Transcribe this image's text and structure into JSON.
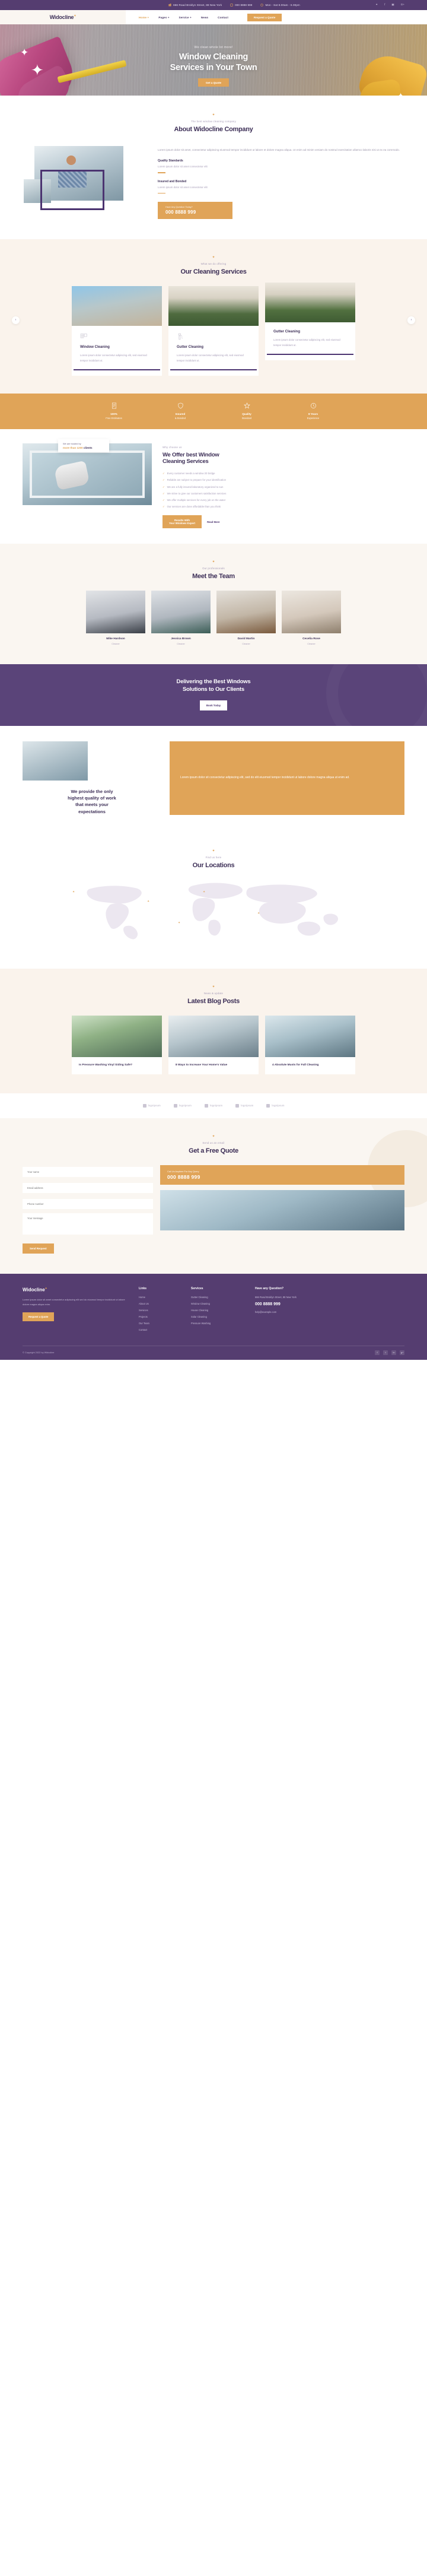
{
  "topbar": {
    "address": "666 Road Broklyn Street, 88 New York",
    "phone": "000 8888 999",
    "hours": "Mon - Sat 8.00am - 6.00pm",
    "social": [
      "twitter-icon",
      "facebook-icon",
      "instagram-icon",
      "google-plus-icon"
    ]
  },
  "nav": {
    "logo": "Widocline",
    "items": [
      {
        "label": "Home +",
        "active": true
      },
      {
        "label": "Pages +",
        "active": false
      },
      {
        "label": "Service +",
        "active": false
      },
      {
        "label": "News",
        "active": false
      },
      {
        "label": "Contact",
        "active": false
      }
    ],
    "cta": "Request a Quote"
  },
  "hero": {
    "eyebrow": "We clean whole lot more!",
    "title_line1": "Window Cleaning",
    "title_line2": "Services in Your Town",
    "button": "Get a Quote"
  },
  "about": {
    "eyebrow": "The best window cleaning company",
    "title": "About Widocline Company",
    "paragraph": "Lorem ipsum dolor sit amet, consectetur adipiscing eiusmod tempor incididunt ut labore et dolore magna aliqua. Ut enim ad minim veniam do nostrud exercitation ullamco laboris nisi ut ex ea commodo.",
    "features": [
      {
        "title": "Quality Standards",
        "text": "Lorem ipsum dolor sit amet consectetur elit"
      },
      {
        "title": "Insured and Bonded",
        "text": "Lorem ipsum dolor sit amet consectetur elit"
      }
    ],
    "call_label": "Have Any Question Today?",
    "call_number": "000 8888 999"
  },
  "services": {
    "eyebrow": "What we do offering",
    "title": "Our Cleaning Services",
    "cards": [
      {
        "title": "Window Cleaning",
        "text": "Lorem ipsum dolor consectetur adipiscing elit, sed eiusmod tempor incididunt ut.",
        "icon": "window-icon"
      },
      {
        "title": "Gutter Cleaning",
        "text": "Lorem ipsum dolor consectetur adipiscing elit, sed eiusmod tempor incididunt ut.",
        "icon": "gutter-icon"
      },
      {
        "title": "Gutter Cleaning",
        "text": "Lorem ipsum dolor consectetur adipiscing elit, sed eiusmod tempor incididunt ut.",
        "icon": "gutter-icon"
      }
    ],
    "prev": "‹",
    "next": "›"
  },
  "stats": [
    {
      "icon": "document-icon",
      "title": "100%",
      "sub": "Free Estimates"
    },
    {
      "icon": "shield-icon",
      "title": "Insured",
      "sub": "& Bonded"
    },
    {
      "icon": "star-icon",
      "title": "Quality",
      "sub": "Standard"
    },
    {
      "icon": "clock-icon",
      "title": "8 Years",
      "sub": "Experience"
    }
  ],
  "offer": {
    "badge_top": "We are trusted by",
    "badge_count": "more than 1200",
    "badge_tail": "clients",
    "eyebrow": "Why choose us",
    "title_line1": "We Offer best Window",
    "title_line2": "Cleaning Services",
    "bullets": [
      "Every customer needs a window 20 bridge",
      "Reliable are subject to prepare for your identification",
      "We are a fully insured laboratory organized to sun",
      "We strive to give our customers satisfaction services",
      "We offer multiple services for every job on the water",
      "Our services are done affordable than you think"
    ],
    "button_l1": "Results With",
    "button_l2": "Your Windows Expert",
    "link": "Read More"
  },
  "team": {
    "eyebrow": "Our professionals",
    "title": "Meet the Team",
    "members": [
      {
        "name": "Mike Hardson",
        "role": "Cleaner"
      },
      {
        "name": "Jessica Brown",
        "role": "Cleaner"
      },
      {
        "name": "David Martin",
        "role": "Cleaner"
      },
      {
        "name": "Cecelia Rose",
        "role": "Cleaner"
      }
    ]
  },
  "cta": {
    "line1": "Delivering the Best Windows",
    "line2": "Solutions to Our Clients",
    "button": "Book Today"
  },
  "quality": {
    "heading_l1": "We provide the only",
    "heading_l2": "highest quality of work",
    "heading_l3": "that meets your",
    "heading_l4": "expectations",
    "paragraph": "Lorem ipsum dolor sit consectetur adipiscing elit, sed do elit eiusmod tempor incididunt ut labore dolore magna aliqua ut enim ad."
  },
  "locations": {
    "eyebrow": "Find us here",
    "title": "Our Locations"
  },
  "blog": {
    "eyebrow": "News & update",
    "title": "Latest Blog Posts",
    "posts": [
      {
        "title": "Is Pressure Washing Vinyl Siding Safe?"
      },
      {
        "title": "8 Ways to Increase Your Home's Value"
      },
      {
        "title": "4 Absolute Musts for Fall Cleaning"
      }
    ]
  },
  "brands": [
    {
      "name": "logoipsum"
    },
    {
      "name": "logoipsum"
    },
    {
      "name": "logoipsum"
    },
    {
      "name": "logoipsum"
    },
    {
      "name": "logoipsum"
    }
  ],
  "quote": {
    "eyebrow": "Send us an email",
    "title": "Get a Free Quote",
    "fields": {
      "name": "Your name",
      "email": "Email address",
      "phone": "Phone number",
      "message": "Your message"
    },
    "submit": "Send Request",
    "phone_label": "Call Us Anytime For Any Query",
    "phone_number": "000 8888 999"
  },
  "footer": {
    "logo": "Widocline",
    "about": "Lorem ipsum dolor sit amet consectetur adipiscing elit sed do eiusmod tempor incididunt ut labore dolore magna aliqua enim.",
    "request_button": "Request a Quote",
    "links_title": "Links",
    "links": [
      "Home",
      "About Us",
      "Services",
      "Projects",
      "Our Team",
      "Contact"
    ],
    "services_title": "Services",
    "services": [
      "Gutter Cleaning",
      "Window Cleaning",
      "House Cleaning",
      "Solar Cleaning",
      "Pressure Washing"
    ],
    "contact_title": "Have any Question?",
    "contact_lines": [
      "666 Road Broklyn Street, 88 New York"
    ],
    "contact_phone": "000 8888 999",
    "contact_email": "help@example.com",
    "copyright": "© Copyright 2022 by Widocline",
    "social": [
      "f",
      "t",
      "in",
      "g+"
    ]
  }
}
